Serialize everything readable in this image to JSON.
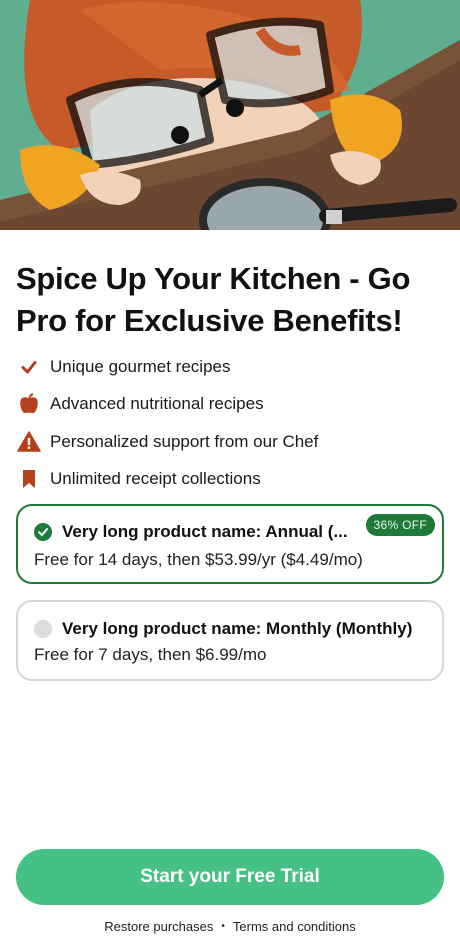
{
  "hero": {
    "image_alt": "Illustration of a child with big glasses peeking over a table with a magnifying glass"
  },
  "title": "Spice Up Your Kitchen - Go Pro for Exclusive Benefits!",
  "features": [
    {
      "icon": "checkmark-icon",
      "label": "Unique gourmet recipes"
    },
    {
      "icon": "apple-icon",
      "label": "Advanced nutritional recipes"
    },
    {
      "icon": "warning-icon",
      "label": "Personalized support from our Chef"
    },
    {
      "icon": "bookmark-icon",
      "label": "Unlimited receipt collections"
    }
  ],
  "plans": [
    {
      "name": "Very long product name: Annual (...",
      "description": "Free for 14 days, then $53.99/yr ($4.49/mo)",
      "badge": "36% OFF",
      "selected": true
    },
    {
      "name": "Very long product name: Monthly (Monthly)",
      "description": "Free for 7 days, then $6.99/mo",
      "selected": false
    }
  ],
  "cta_label": "Start your Free Trial",
  "footer": {
    "restore": "Restore purchases",
    "separator": "•",
    "terms": "Terms and conditions"
  },
  "colors": {
    "accent_green": "#1f7a3a",
    "cta_green": "#45c283",
    "feature_icon": "#b5401e"
  }
}
